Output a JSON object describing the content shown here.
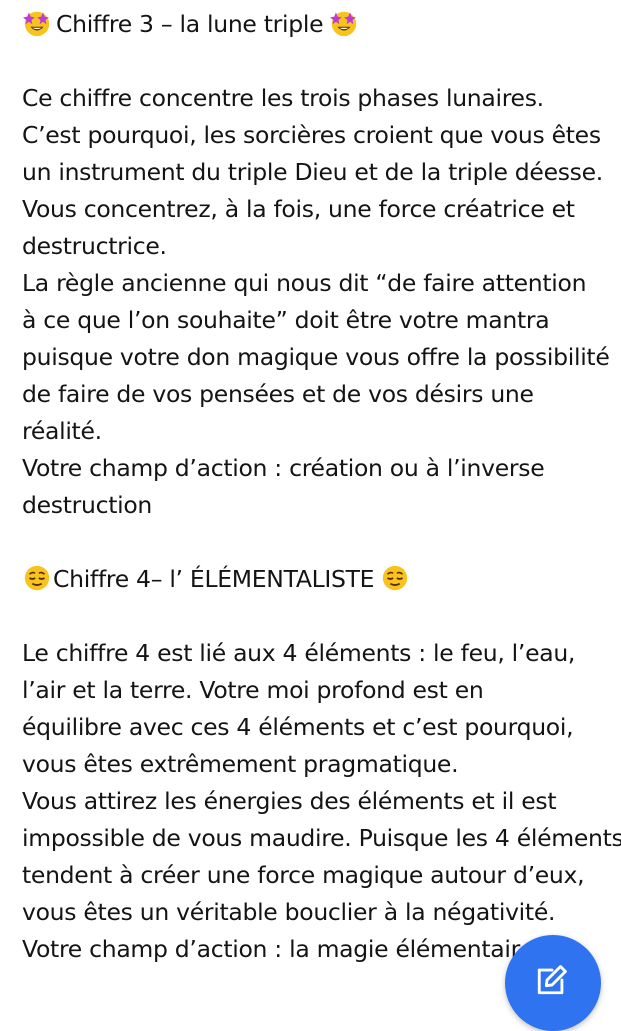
{
  "post": {
    "section3": {
      "title_emoji": "star-struck-emoji",
      "title": "Chiffre 3 – la lune triple",
      "lines": [
        "Ce chiffre concentre les trois phases lunaires.",
        "C’est pourquoi, les sorcières croient que vous êtes",
        "un instrument du triple Dieu et de la triple déesse.",
        "Vous concentrez, à la fois, une force créatrice et",
        "destructrice.",
        "La règle ancienne qui nous dit “de faire attention",
        "à ce que l’on souhaite” doit être votre mantra",
        "puisque votre don magique vous offre la possibilité",
        "de faire de vos pensées et de vos désirs une",
        "réalité.",
        "Votre champ d’action : création ou à l’inverse",
        "destruction"
      ]
    },
    "section4": {
      "title_emoji": "relieved-face-emoji",
      "title": "Chiffre 4– l’ ÉLÉMENTALISTE",
      "lines": [
        "Le chiffre 4 est lié aux 4 éléments : le feu, l’eau,",
        "l’air et la terre. Votre moi profond est en",
        "équilibre avec ces 4 éléments et c’est pourquoi,",
        "vous êtes extrêmement pragmatique.",
        "Vous attirez les énergies des éléments et il est",
        "impossible de vous maudire. Puisque les 4 éléments",
        "tendent à créer une force magique autour d’eux,",
        "vous êtes un véritable bouclier à la négativité.",
        "Votre champ d’action : la magie élémentair"
      ]
    }
  },
  "fab": {
    "icon": "edit-icon",
    "color": "#2f73f0"
  }
}
